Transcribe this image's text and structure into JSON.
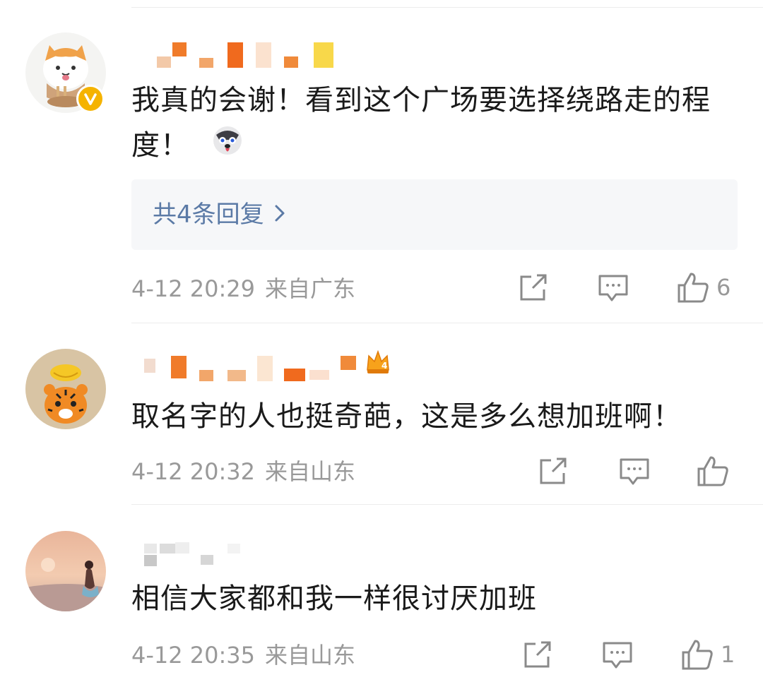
{
  "comments": [
    {
      "text": "我真的会谢！看到这个广场要选择绕路走的程度！",
      "emoji": "husky-emoji",
      "verified": true,
      "replies_label": "共4条回复",
      "time": "4-12 20:29",
      "location": "来自广东",
      "likes": "6"
    },
    {
      "text": "取名字的人也挺奇葩，这是多么想加班啊！",
      "badge": "4",
      "time": "4-12 20:32",
      "location": "来自山东",
      "likes": ""
    },
    {
      "text": "相信大家都和我一样很讨厌加班",
      "time": "4-12 20:35",
      "location": "来自山东",
      "likes": "1"
    }
  ],
  "colors": {
    "link_blue": "#5b7aa6",
    "meta_gray": "#999999",
    "verified_gold": "#f5b300"
  }
}
